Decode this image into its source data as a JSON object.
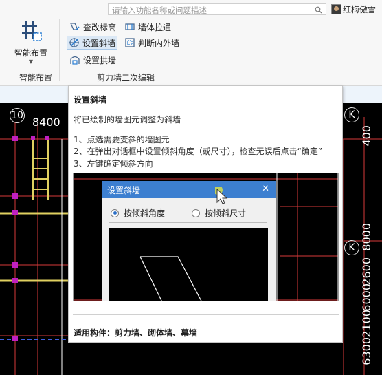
{
  "search": {
    "placeholder": "请输入功能名称或问题描述"
  },
  "user": {
    "name": "红梅傲雪"
  },
  "ribbon": {
    "smart_layout": {
      "button_label": "智能布置",
      "group_label": "智能布置"
    },
    "shear_wall_group": {
      "group_label": "剪力墙二次编辑",
      "buttons": [
        {
          "label": "查改标高",
          "icon": "edit-elevation-icon"
        },
        {
          "label": "墙体拉通",
          "icon": "wall-extend-icon"
        },
        {
          "label": "设置斜墙",
          "icon": "inclined-wall-icon"
        },
        {
          "label": "判断内外墙",
          "icon": "inner-outer-wall-icon"
        },
        {
          "label": "设置拱墙",
          "icon": "arch-wall-icon"
        }
      ]
    }
  },
  "cad": {
    "axis_labels": [
      "10",
      "8400",
      "K",
      "K"
    ],
    "right_dims": [
      "400",
      "6300",
      "2100",
      "6000",
      "2600",
      "8000"
    ],
    "colors": {
      "background": "#000000",
      "wall": "#e0d060",
      "grid": "#e03030",
      "node": "#c020c0"
    }
  },
  "tooltip": {
    "title": "设置斜墙",
    "description": "将已绘制的墙图元调整为斜墙",
    "steps": [
      "1、点选需要变斜的墙图元",
      "2、在弹出对话框中设置倾斜角度（或尺寸），检查无误后点击“确定”",
      "3、左键确定倾斜方向"
    ],
    "applicable": "适用构件：剪力墙、砌体墙、幕墙",
    "preview_dialog": {
      "title": "设置斜墙",
      "close": "✕",
      "option_angle": "按倾斜角度",
      "option_size": "按倾斜尺寸",
      "selected": "按倾斜角度"
    }
  },
  "accent_color": "#3c7fd0"
}
